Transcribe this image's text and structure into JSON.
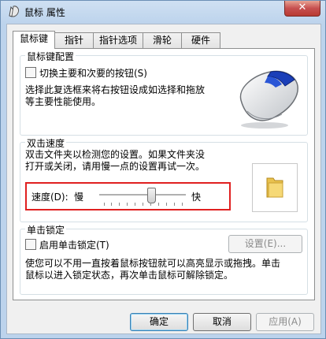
{
  "window": {
    "title": "鼠标 属性",
    "close_label": "✕"
  },
  "tabs": [
    {
      "label": "鼠标键"
    },
    {
      "label": "指针"
    },
    {
      "label": "指针选项"
    },
    {
      "label": "滑轮"
    },
    {
      "label": "硬件"
    }
  ],
  "button_config": {
    "title": "鼠标键配置",
    "checkbox_label": "切换主要和次要的按钮(S)",
    "checked": false,
    "description_line1": "选择此复选框来将右按钮设成如选择和拖放",
    "description_line2": "等主要性能使用。"
  },
  "double_click": {
    "title": "双击速度",
    "description_line1": "双击文件夹以检测您的设置。如果文件夹没",
    "description_line2": "打开或关闭，请用慢一点的设置再试一次。",
    "speed_label": "速度(D):",
    "slow_label": "慢",
    "fast_label": "快",
    "speed_value": 0.62
  },
  "click_lock": {
    "title": "单击锁定",
    "checkbox_label": "启用单击锁定(T)",
    "checked": false,
    "settings_button": "设置(E)...",
    "description_line1": "使您可以不用一直按着鼠标按钮就可以高亮显示或拖拽。单击",
    "description_line2": "鼠标以进入锁定状态，再次单击鼠标可解除锁定。"
  },
  "footer": {
    "ok": "确定",
    "cancel": "取消",
    "apply": "应用(A)"
  },
  "icons": {
    "title": "mouse-icon",
    "preview": "mouse-preview-icon",
    "folder": "folder-icon"
  }
}
